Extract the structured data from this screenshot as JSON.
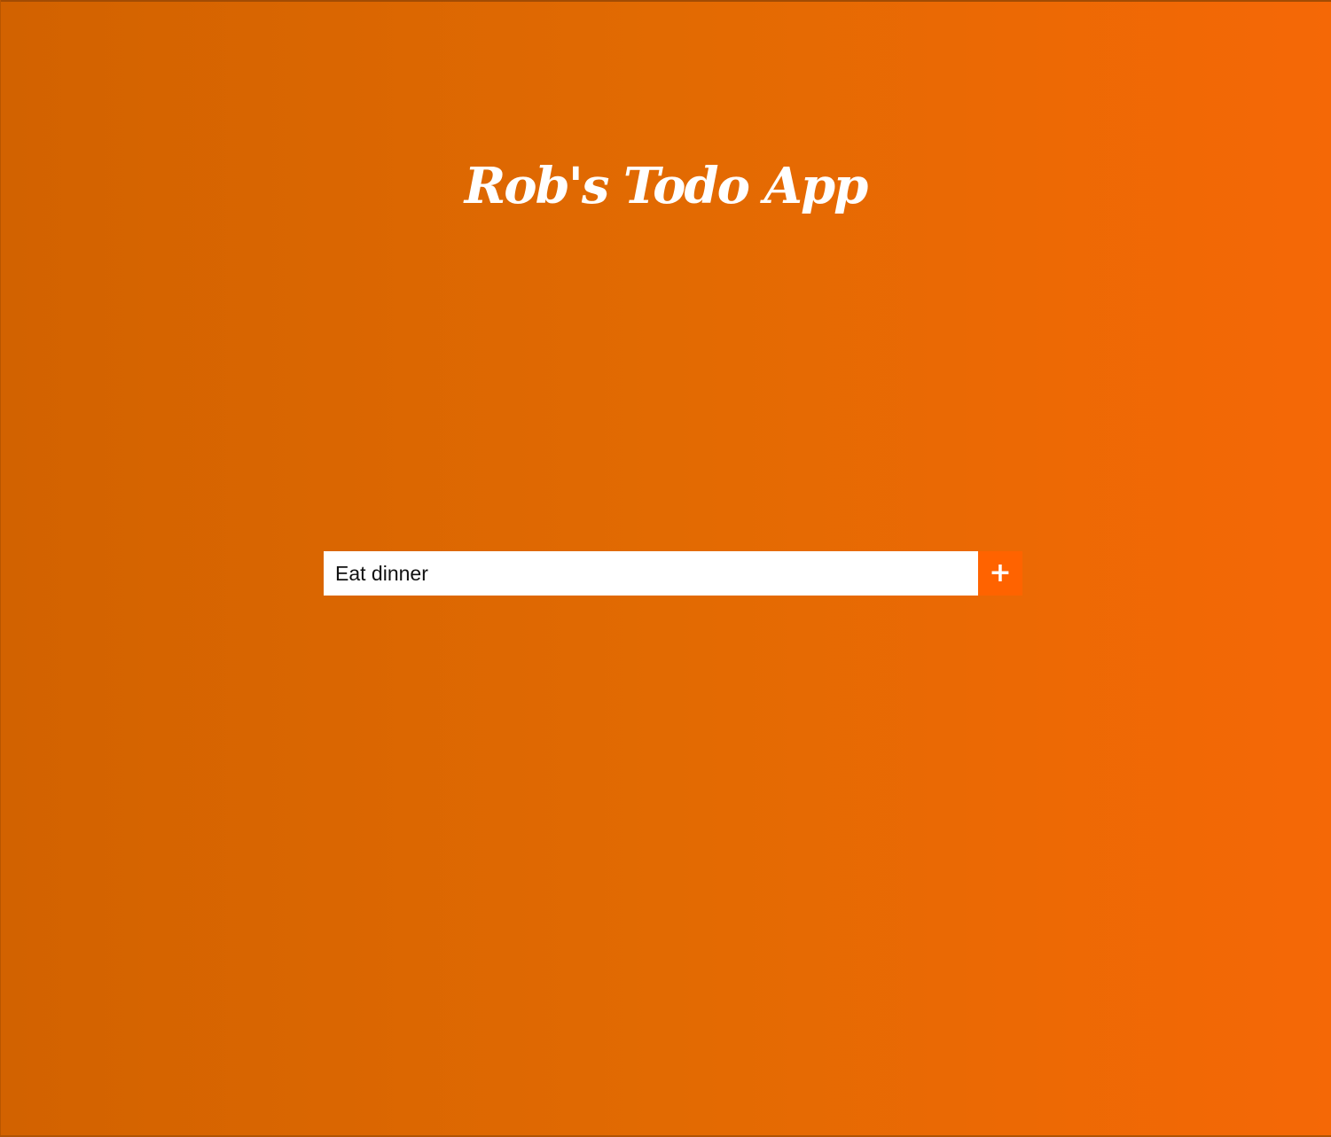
{
  "app": {
    "title": "Rob's Todo App"
  },
  "todo_form": {
    "input_value": "Eat dinner",
    "add_button_label": "+"
  },
  "colors": {
    "background_left": "#d26200",
    "background_right": "#f56806",
    "add_button": "#ff6300",
    "title_text": "#ffffff"
  }
}
